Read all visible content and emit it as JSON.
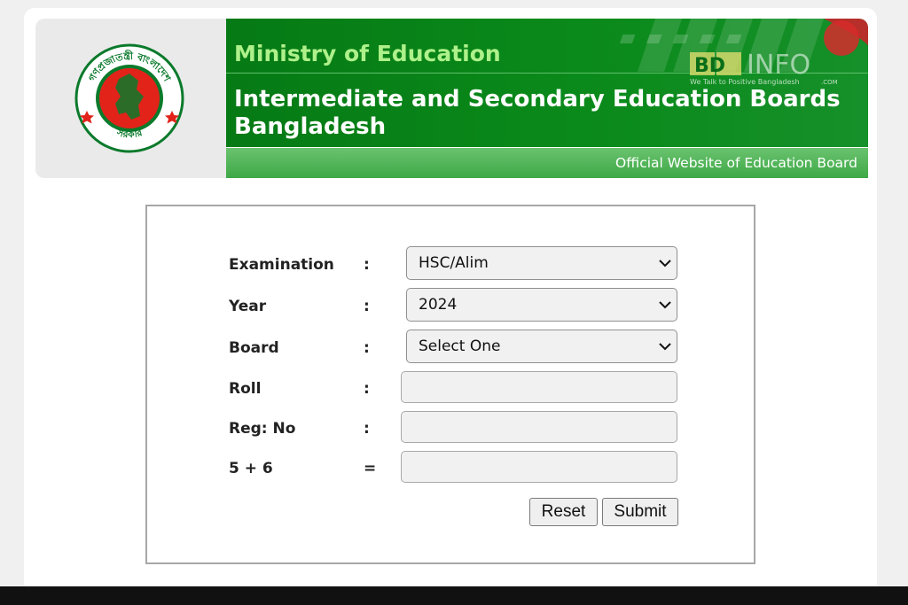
{
  "header": {
    "ministry": "Ministry of Education",
    "title": "Intermediate and Secondary Education Boards Bangladesh",
    "official": "Official Website of Education Board",
    "watermark": {
      "brand_left": "BD",
      "brand_right": "INFO",
      "tagline": "We Talk to Positive Bangladesh",
      "suffix": ".COM"
    }
  },
  "seal": {
    "top_text": "গণপ্রজাতন্ত্রী বাংলাদেশ",
    "bottom_text": "সরকার"
  },
  "form": {
    "examination": {
      "label": "Examination",
      "sep": ":",
      "value": "HSC/Alim"
    },
    "year": {
      "label": "Year",
      "sep": ":",
      "value": "2024"
    },
    "board": {
      "label": "Board",
      "sep": ":",
      "value": "Select One"
    },
    "roll": {
      "label": "Roll",
      "sep": ":",
      "value": ""
    },
    "reg": {
      "label": "Reg: No",
      "sep": ":",
      "value": ""
    },
    "captcha": {
      "label": "5 + 6",
      "sep": "=",
      "value": ""
    },
    "reset_label": "Reset",
    "submit_label": "Submit"
  },
  "colors": {
    "banner_green": "#0a8a1a",
    "ministry_text": "#aef08a",
    "strip_green": "#4fb356",
    "seal_red": "#e2231a",
    "seal_green": "#0a7a2b"
  }
}
